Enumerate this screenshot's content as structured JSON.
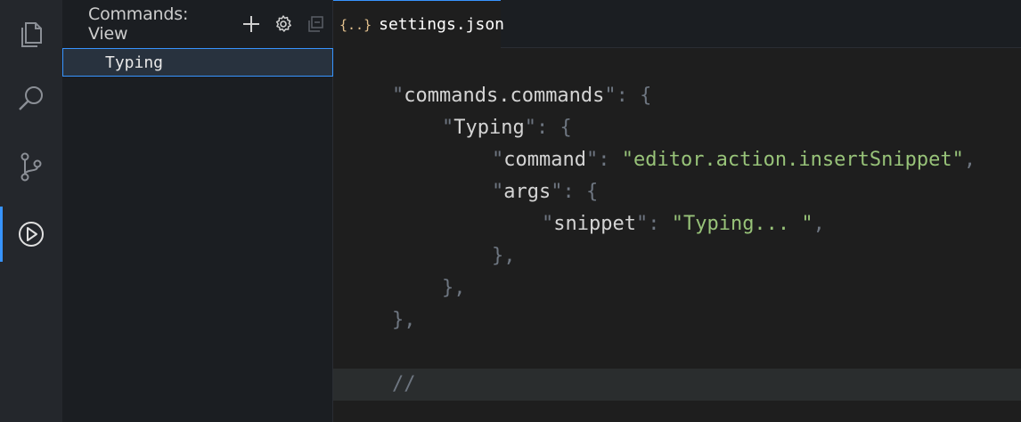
{
  "activity_bar": {
    "items": [
      {
        "icon": "files-icon"
      },
      {
        "icon": "search-icon"
      },
      {
        "icon": "source-control-icon"
      },
      {
        "icon": "run-icon",
        "active": true
      }
    ]
  },
  "sidebar": {
    "title": "Commands: View",
    "actions": [
      "add-icon",
      "gear-icon",
      "collapse-all-icon"
    ],
    "items": [
      {
        "label": "Typing",
        "selected": true
      }
    ]
  },
  "tabs": [
    {
      "icon_text": "{..}",
      "label": "settings.json",
      "active": true
    }
  ],
  "editor": {
    "lines": [
      {
        "indent": 1,
        "tokens": [
          [
            "punc",
            "\""
          ],
          [
            "key",
            "commands.commands"
          ],
          [
            "punc",
            "\": {"
          ]
        ]
      },
      {
        "indent": 2,
        "tokens": [
          [
            "punc",
            "\""
          ],
          [
            "key",
            "Typing"
          ],
          [
            "punc",
            "\": {"
          ]
        ]
      },
      {
        "indent": 3,
        "tokens": [
          [
            "punc",
            "\""
          ],
          [
            "key",
            "command"
          ],
          [
            "punc",
            "\": "
          ],
          [
            "str",
            "\"editor.action.insertSnippet\""
          ],
          [
            "punc",
            ","
          ]
        ]
      },
      {
        "indent": 3,
        "tokens": [
          [
            "punc",
            "\""
          ],
          [
            "key",
            "args"
          ],
          [
            "punc",
            "\": {"
          ]
        ]
      },
      {
        "indent": 4,
        "tokens": [
          [
            "punc",
            "\""
          ],
          [
            "key",
            "snippet"
          ],
          [
            "punc",
            "\": "
          ],
          [
            "str",
            "\"Typing... \""
          ],
          [
            "punc",
            ","
          ]
        ]
      },
      {
        "indent": 3,
        "tokens": [
          [
            "punc",
            "},"
          ]
        ]
      },
      {
        "indent": 2,
        "tokens": [
          [
            "punc",
            "},"
          ]
        ]
      },
      {
        "indent": 1,
        "tokens": [
          [
            "punc",
            "},"
          ]
        ]
      },
      {
        "indent": 0,
        "tokens": []
      },
      {
        "indent": 1,
        "tokens": [
          [
            "cmt",
            "//"
          ]
        ],
        "current": true
      }
    ]
  },
  "colors": {
    "accent": "#3794ff",
    "string": "#98c379",
    "json_icon": "#e2c08d"
  }
}
